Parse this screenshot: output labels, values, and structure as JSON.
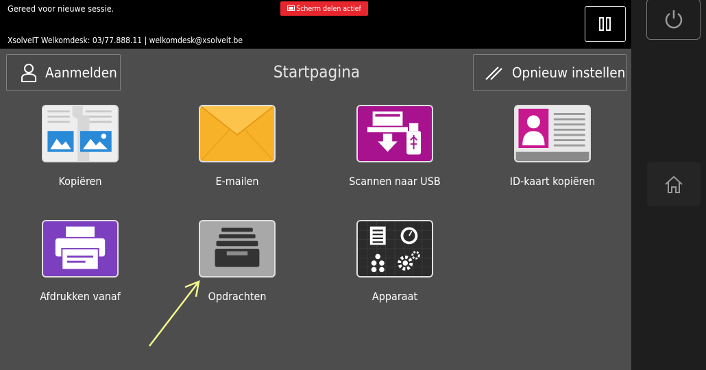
{
  "status": {
    "message": "Gereed voor nieuwe sessie.",
    "helpdesk": "XsolveIT Welkomdesk: 03/77.888.11 | welkomdesk@xsolveit.be",
    "share_badge": "Scherm delen actief"
  },
  "header": {
    "login_label": "Aanmelden",
    "title": "Startpagina",
    "reset_label": "Opnieuw instellen"
  },
  "apps": [
    {
      "label": "Kopiëren",
      "icon": "copy-icon"
    },
    {
      "label": "E-mailen",
      "icon": "envelope-icon"
    },
    {
      "label": "Scannen naar USB",
      "icon": "scan-usb-icon"
    },
    {
      "label": "ID-kaart kopiëren",
      "icon": "id-card-icon"
    },
    {
      "label": "Afdrukken vanaf",
      "icon": "printer-icon"
    },
    {
      "label": "Opdrachten",
      "icon": "jobs-tray-icon"
    },
    {
      "label": "Apparaat",
      "icon": "device-icon"
    }
  ],
  "side": {
    "power": "power-icon",
    "home": "home-icon"
  },
  "colors": {
    "screen_bg": "#4d4d4d",
    "status_bg": "#000000",
    "share_badge": "#e8262d",
    "email_tile": "#f8b22a",
    "scan_usb_tile": "#a8128e",
    "print_tile": "#7c3fbf",
    "annotation_arrow": "#f3f98c"
  }
}
